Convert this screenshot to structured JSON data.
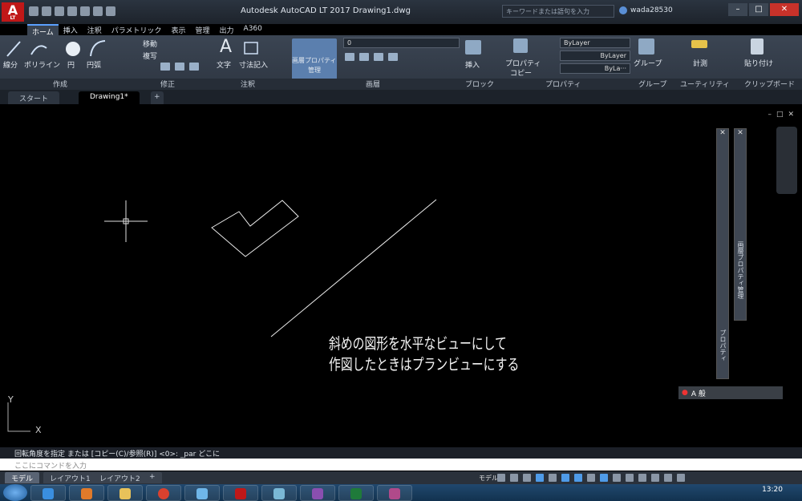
{
  "titlebar": {
    "title": "Autodesk AutoCAD LT 2017    Drawing1.dwg",
    "search_placeholder": "キーワードまたは語句を入力",
    "username": "wada28530",
    "app_logo": "A",
    "app_logo_sub": "LT"
  },
  "ribbon_tabs": [
    "ホーム",
    "挿入",
    "注釈",
    "パラメトリック",
    "表示",
    "管理",
    "出力",
    "A360"
  ],
  "ribbon": {
    "draw": {
      "line": "線分",
      "polyline": "ポリライン",
      "circle": "円",
      "arc": "円弧",
      "label": "作成"
    },
    "modify": {
      "move": "移動",
      "copy": "複写",
      "label": "修正"
    },
    "annotation": {
      "text": "文字",
      "dimension": "寸法記入",
      "label": "注釈"
    },
    "layers": {
      "layer_props_1": "画層プロパティ",
      "layer_props_2": "管理",
      "layer_value": "0",
      "label": "画層"
    },
    "block": {
      "insert": "挿入",
      "label": "ブロック"
    },
    "properties": {
      "match_1": "プロパティ",
      "match_2": "コピー",
      "color": "ByLayer",
      "linetype": "ByLayer",
      "lineweight": "ByLa···",
      "label": "プロパティ"
    },
    "groups": {
      "group": "グループ",
      "label": "グループ"
    },
    "utilities": {
      "measure": "計測",
      "label": "ユーティリティ"
    },
    "clipboard": {
      "paste": "貼り付け",
      "label": "クリップボード"
    }
  },
  "doc_tabs": {
    "start": "スタート",
    "drawing": "Drawing1*"
  },
  "canvas": {
    "note_line1": "斜めの図形を水平なビューにして",
    "note_line2": "作図したときはプランビューにする",
    "ucs_x": "X",
    "ucs_y": "Y",
    "palette_properties": "プロパティ",
    "palette_layers": "画層プロパティ管理",
    "ime_text": "A 般"
  },
  "command": {
    "history": "回転角度を指定 または [コピー(C)/参照(R)] <0>: _par どこに",
    "placeholder": "ここにコマンドを入力"
  },
  "layout_tabs": [
    "モデル",
    "レイアウト1",
    "レイアウト2"
  ],
  "status": {
    "model": "モデル"
  },
  "taskbar": {
    "time": "13:20"
  }
}
